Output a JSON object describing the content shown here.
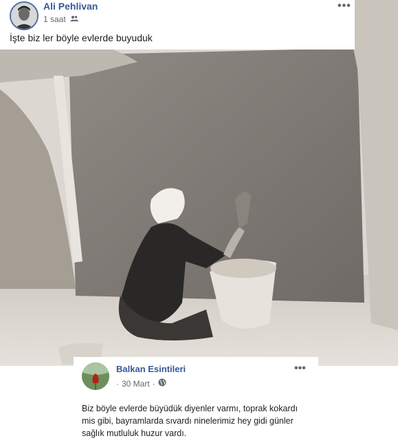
{
  "post": {
    "author": "Ali Pehlivan",
    "time": "1 saat",
    "audience_icon": "friends-icon",
    "text": "İşte biz ler böyle evlerde buyuduk",
    "more_label": "•••"
  },
  "shared": {
    "author": "Balkan Esintileri",
    "time": "30 Mart",
    "separator": "·",
    "audience_icon": "globe-icon",
    "more_label": "•••",
    "text": "Biz böyle evlerde büyüdük diyenler varmı, toprak kokardı mis gibi, bayramlarda sıvardı ninelerimiz hey gidi günler sağlık mutluluk huzur vardı."
  },
  "colors": {
    "name_link": "#365899",
    "meta_text": "#606770",
    "body_text": "#1c1e21"
  }
}
